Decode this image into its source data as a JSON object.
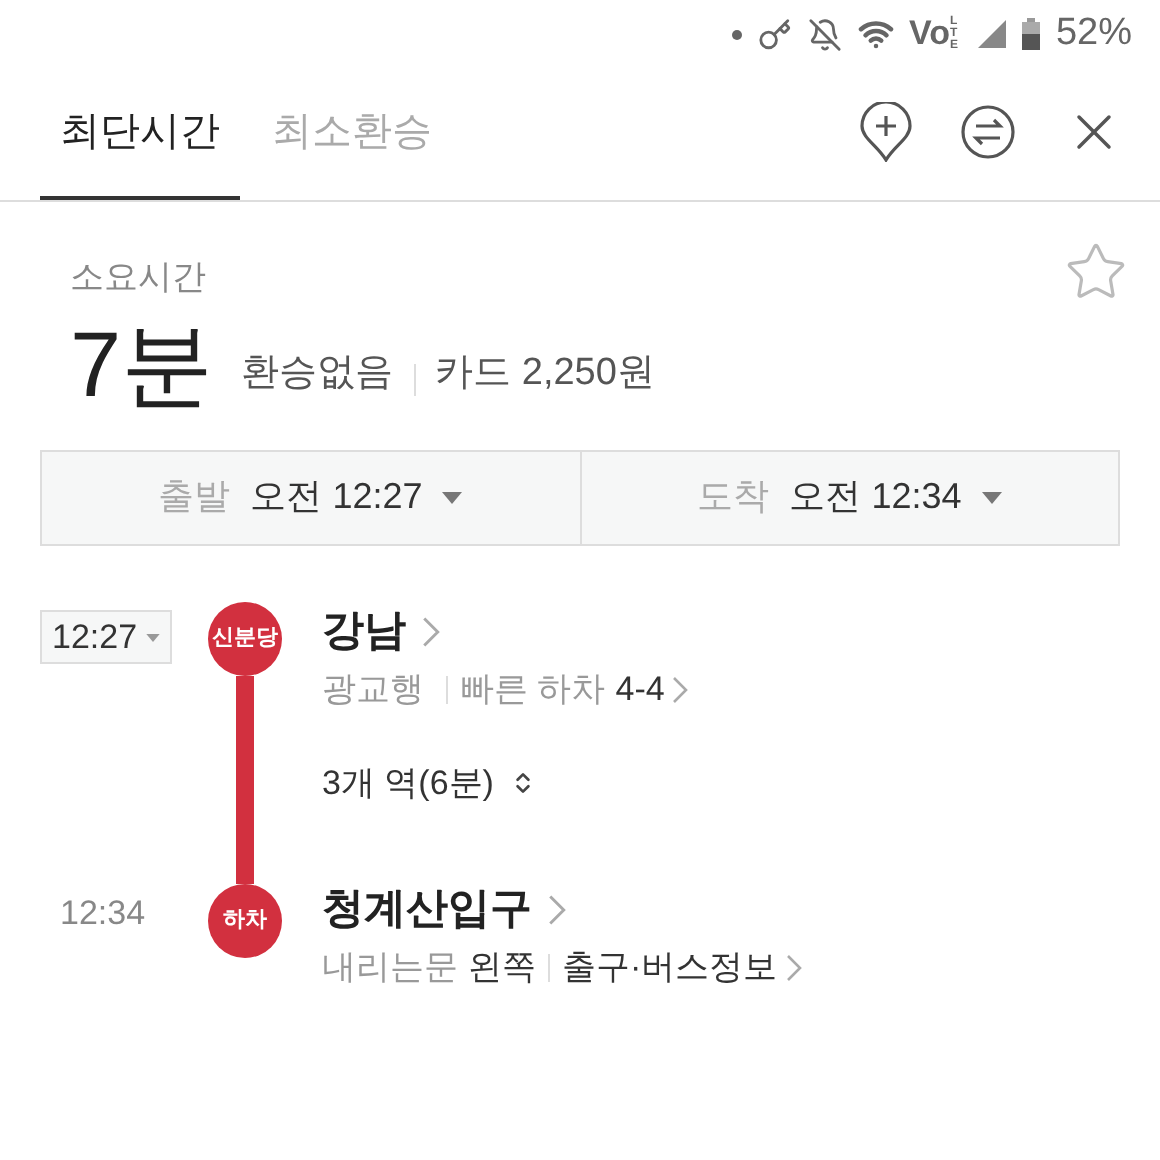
{
  "status_bar": {
    "network": "Vo",
    "network_type": "LTE",
    "battery": "52%"
  },
  "tabs": [
    {
      "label": "최단시간",
      "selected": true
    },
    {
      "label": "최소환승",
      "selected": false
    }
  ],
  "summary": {
    "label": "소요시간",
    "duration": "7분",
    "transfers": "환승없음",
    "fare": "카드 2,250원",
    "favorite": false
  },
  "times": [
    {
      "label": "출발",
      "value": "오전 12:27"
    },
    {
      "label": "도착",
      "value": "오전 12:34"
    }
  ],
  "route": {
    "color": "#d2303f",
    "segment": "3개 역(6분)",
    "stops": [
      {
        "time": "12:27",
        "time_editable": true,
        "badge": "신분당",
        "name": "강남",
        "details": [
          {
            "label": "광교행"
          },
          {
            "label": "빠른 하차",
            "value": "4-4",
            "link": true
          }
        ]
      },
      {
        "time": "12:34",
        "time_editable": false,
        "badge": "하차",
        "name": "청계산입구",
        "details": [
          {
            "label": "내리는문",
            "value": "왼쪽"
          },
          {
            "value": "출구·버스정보",
            "link": true
          }
        ]
      }
    ]
  }
}
